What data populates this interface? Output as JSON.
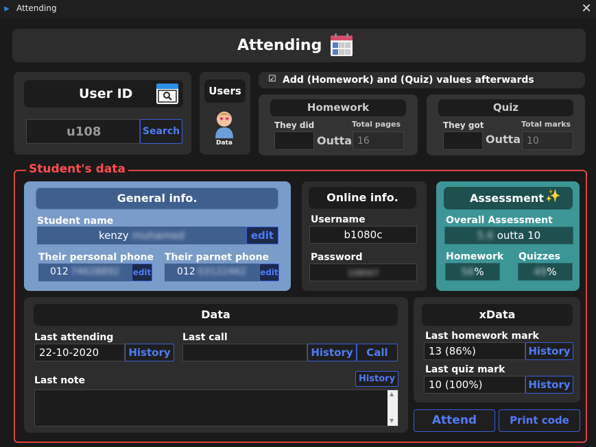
{
  "window": {
    "title": "Attending",
    "close": "✕"
  },
  "header": {
    "title": "Attending"
  },
  "user_id": {
    "title": "User ID",
    "value": "u108",
    "search": "Search"
  },
  "users": {
    "title": "Users",
    "avatar_label": "Data"
  },
  "options": {
    "checkbox_label": "Add (Homework) and (Quiz) values afterwards",
    "checked": true
  },
  "homework": {
    "title": "Homework",
    "they_did": "They did",
    "outta": "Outta",
    "total_pages_label": "Total pages",
    "total_pages": "16"
  },
  "quiz": {
    "title": "Quiz",
    "they_got": "They got",
    "outta": "Outta",
    "total_marks_label": "Total marks",
    "total_marks": "10"
  },
  "students_data": {
    "legend": "Student's data"
  },
  "general": {
    "title": "General info.",
    "name_label": "Student name",
    "name_first": "kenzy",
    "name_last": "muhamed",
    "edit": "edit",
    "personal_phone_label": "Their personal phone",
    "personal_phone_prefix": "012",
    "personal_phone_rest": "74628892",
    "parent_phone_label": "Their parnet phone",
    "parent_phone_prefix": "012",
    "parent_phone_rest": "03122462"
  },
  "online": {
    "title": "Online info.",
    "username_label": "Username",
    "username": "b1080c",
    "password_label": "Password",
    "password": "108007"
  },
  "assessment": {
    "title": "Assessment",
    "overall_label": "Overall Assessment",
    "overall_value": "5.6",
    "overall_suffix": "outta 10",
    "homework_label": "Homework",
    "homework_value": "56",
    "quizzes_label": "Quizzes",
    "quizzes_value": "49",
    "percent": "%"
  },
  "data": {
    "title": "Data",
    "last_attending_label": "Last attending",
    "last_attending": "22-10-2020",
    "last_call_label": "Last call",
    "last_call": "",
    "last_note_label": "Last note",
    "last_note": "",
    "history": "History",
    "call": "Call"
  },
  "xdata": {
    "title": "xData",
    "last_hw_label": "Last homework mark",
    "last_hw": "13 (86%)",
    "last_quiz_label": "Last quiz mark",
    "last_quiz": "10 (100%)",
    "history": "History"
  },
  "actions": {
    "attend": "Attend",
    "print": "Print code"
  },
  "colors": {
    "accent": "#4f7cf5",
    "frame": "#e04545",
    "general_bg": "#7a9cc9",
    "assessment_bg": "#3c9696"
  }
}
